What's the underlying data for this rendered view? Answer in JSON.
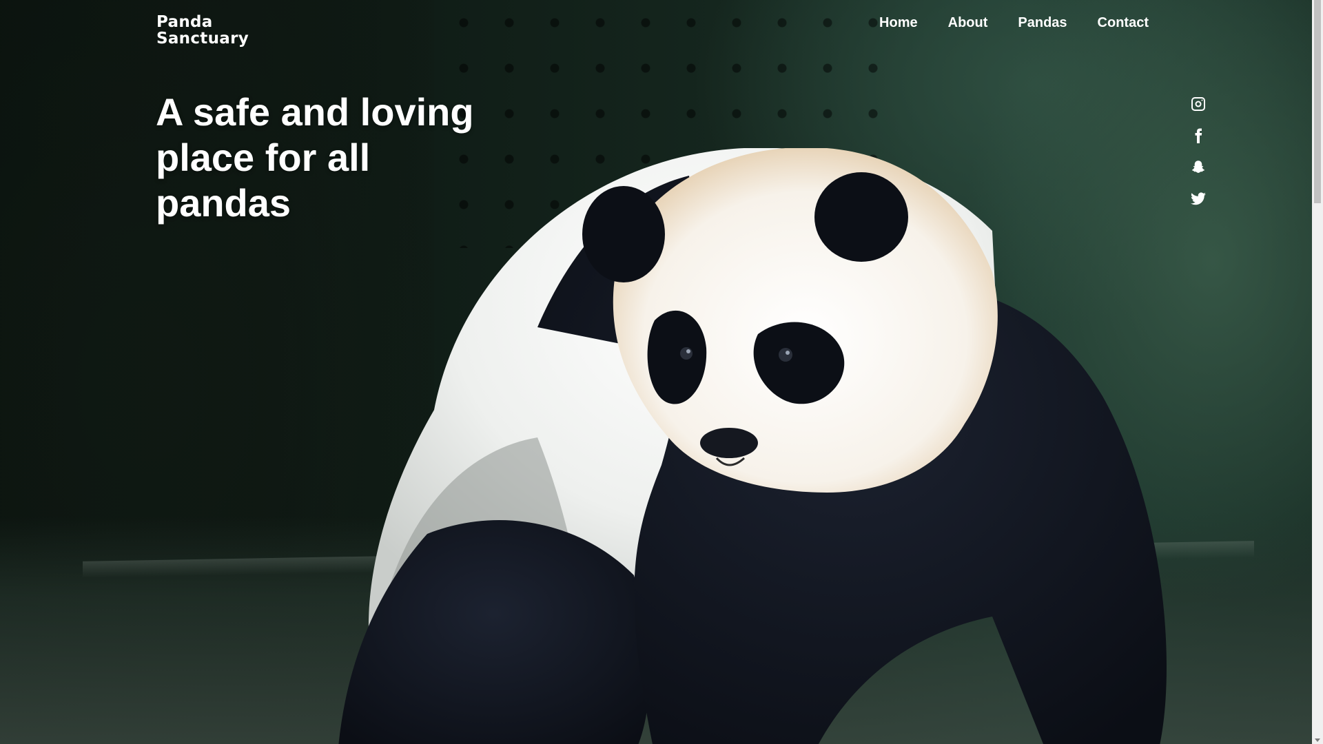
{
  "brand": {
    "line1": "Panda",
    "line2": "Sanctuary"
  },
  "nav": {
    "items": [
      {
        "label": "Home"
      },
      {
        "label": "About"
      },
      {
        "label": "Pandas"
      },
      {
        "label": "Contact"
      }
    ]
  },
  "hero": {
    "title": "A safe and loving place for all pandas"
  },
  "social": {
    "icons": [
      "instagram-icon",
      "facebook-icon",
      "snapchat-icon",
      "twitter-icon"
    ]
  },
  "colors": {
    "text": "#ffffff",
    "background": "#14261e",
    "scrollbar_track": "#f0f0f0",
    "scrollbar_thumb": "#c1c1c1"
  }
}
